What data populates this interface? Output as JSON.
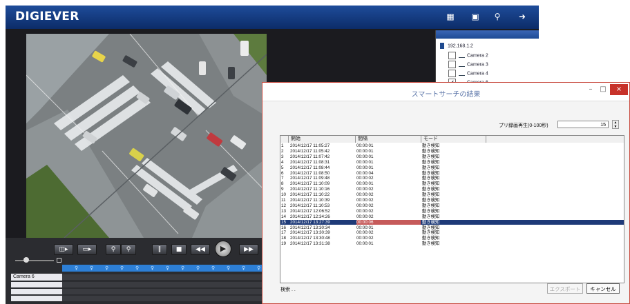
{
  "app": {
    "title": "DIGIEVER",
    "toolbar_icons": [
      "monitor-grid-icon",
      "playback-icon",
      "search-icon",
      "logout-icon"
    ]
  },
  "camera_tree": {
    "server": "192.168.1.2",
    "cameras": [
      {
        "name": "Camera 2",
        "checked": false
      },
      {
        "name": "Camera 3",
        "checked": false
      },
      {
        "name": "Camera 4",
        "checked": false
      },
      {
        "name": "Camera 6",
        "checked": true
      }
    ]
  },
  "playback": {
    "camera_label": "Camera 6",
    "controls": [
      "layout-icon",
      "snapshot-icon",
      "zoom-out-icon",
      "zoom-in-icon",
      "pause-icon",
      "stop-icon",
      "rewind-icon",
      "play-icon",
      "fast-forward-icon"
    ]
  },
  "dialog": {
    "title": "スマートサーチの結果",
    "minimize": "–",
    "maximize": "□",
    "close": "×",
    "prerecord_label": "プリ録画再生(0-100秒)",
    "prerecord_value": "15",
    "columns": {
      "start": "開始",
      "duration": "間隔",
      "mode": "モード"
    },
    "rows": [
      {
        "no": "1",
        "start": "2014/12/17 11:05:27",
        "duration": "00:00:01",
        "mode": "動き検知"
      },
      {
        "no": "2",
        "start": "2014/12/17 11:05:42",
        "duration": "00:00:01",
        "mode": "動き検知"
      },
      {
        "no": "3",
        "start": "2014/12/17 11:07:42",
        "duration": "00:00:01",
        "mode": "動き検知"
      },
      {
        "no": "4",
        "start": "2014/12/17 11:08:31",
        "duration": "00:00:01",
        "mode": "動き検知"
      },
      {
        "no": "5",
        "start": "2014/12/17 11:08:44",
        "duration": "00:00:01",
        "mode": "動き検知"
      },
      {
        "no": "6",
        "start": "2014/12/17 11:08:50",
        "duration": "00:00:04",
        "mode": "動き検知"
      },
      {
        "no": "7",
        "start": "2014/12/17 11:09:48",
        "duration": "00:00:02",
        "mode": "動き検知"
      },
      {
        "no": "8",
        "start": "2014/12/17 11:10:09",
        "duration": "00:00:01",
        "mode": "動き検知"
      },
      {
        "no": "9",
        "start": "2014/12/17 11:10:16",
        "duration": "00:00:02",
        "mode": "動き検知"
      },
      {
        "no": "10",
        "start": "2014/12/17 11:10:22",
        "duration": "00:00:02",
        "mode": "動き検知"
      },
      {
        "no": "11",
        "start": "2014/12/17 11:10:39",
        "duration": "00:00:02",
        "mode": "動き検知"
      },
      {
        "no": "12",
        "start": "2014/12/17 11:10:53",
        "duration": "00:00:02",
        "mode": "動き検知"
      },
      {
        "no": "13",
        "start": "2014/12/17 12:06:52",
        "duration": "00:00:02",
        "mode": "動き検知"
      },
      {
        "no": "14",
        "start": "2014/12/17 12:34:26",
        "duration": "00:00:02",
        "mode": "動き検知"
      },
      {
        "no": "15",
        "start": "2014/12/17 13:27:39",
        "duration": "00:00:06",
        "mode": "動き検知",
        "selected": true
      },
      {
        "no": "16",
        "start": "2014/12/17 13:30:34",
        "duration": "00:00:01",
        "mode": "動き検知"
      },
      {
        "no": "17",
        "start": "2014/12/17 13:30:39",
        "duration": "00:00:02",
        "mode": "動き検知"
      },
      {
        "no": "18",
        "start": "2014/12/17 13:30:48",
        "duration": "00:00:02",
        "mode": "動き検知"
      },
      {
        "no": "19",
        "start": "2014/12/17 13:31:38",
        "duration": "00:00:01",
        "mode": "動き検知"
      }
    ],
    "status": "検索 . .",
    "export_label": "エクスポート",
    "cancel_label": "キャンセル"
  }
}
